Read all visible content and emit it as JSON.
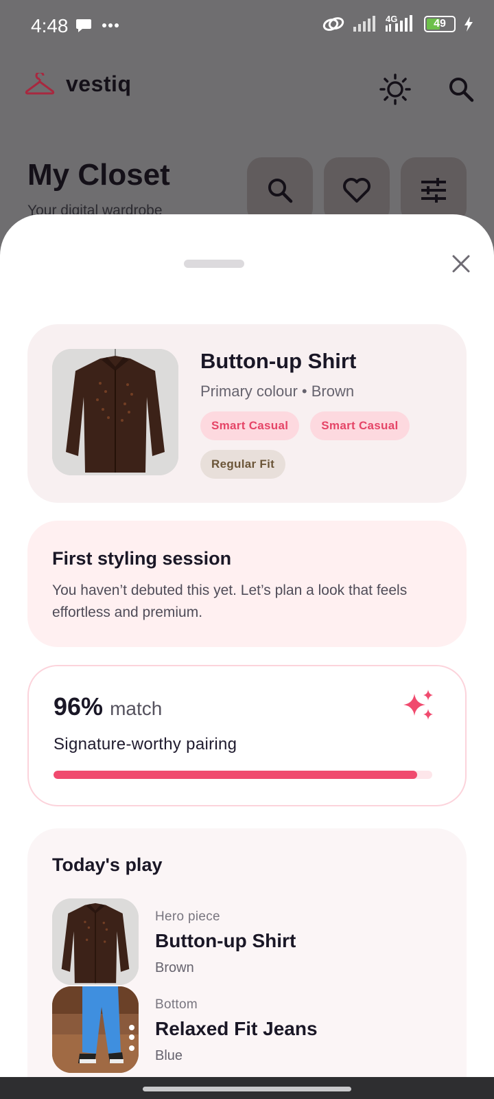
{
  "status_bar": {
    "time": "4:48",
    "network": "4G",
    "battery": "49",
    "battery_level": 0.49,
    "icons": [
      "chat-bubble-icon",
      "more-dots-icon",
      "link-icon",
      "signal-icon",
      "signal-4g-icon",
      "battery-icon",
      "charging-icon"
    ]
  },
  "app_bar": {
    "brand": "vestiq",
    "brand_icon": "hanger-icon",
    "actions": [
      "theme-toggle-icon",
      "search-icon"
    ]
  },
  "page": {
    "title": "My Closet",
    "subtitle": "Your digital wardrobe",
    "actions": [
      "search-icon",
      "heart-icon",
      "filter-sliders-icon"
    ]
  },
  "sheet": {
    "close_icon": "close-icon",
    "item": {
      "name": "Button-up Shirt",
      "primary_colour": "Primary colour • Brown",
      "tags": [
        {
          "label": "Smart Casual",
          "style": "pink"
        },
        {
          "label": "Smart Casual",
          "style": "pink"
        },
        {
          "label": "Regular Fit",
          "style": "beige"
        }
      ]
    },
    "session": {
      "title": "First styling session",
      "body": "You haven’t debuted this yet. Let’s plan a look that feels effortless and premium."
    },
    "match": {
      "value": "96%",
      "percent": 96,
      "word": "match",
      "description": "Signature-worthy pairing",
      "icon": "sparkle-icon"
    },
    "today": {
      "title": "Today's play",
      "looks": [
        {
          "role": "Hero piece",
          "name": "Button-up Shirt",
          "color": "Brown"
        },
        {
          "role": "Bottom",
          "name": "Relaxed Fit Jeans",
          "color": "Blue"
        }
      ]
    }
  },
  "colors": {
    "accent": "#f04a6e",
    "accent_soft": "#fdd9df",
    "brand_icon": "#a8283f",
    "scrim": "#6f6e70"
  }
}
